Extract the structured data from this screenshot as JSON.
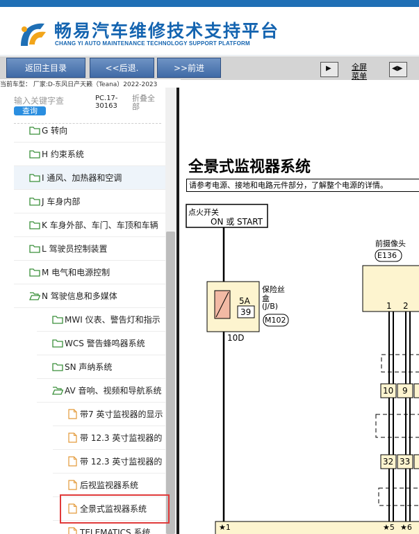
{
  "header": {
    "title": "畅易汽车维修技术支持平台",
    "subtitle": "CHANG YI AUTO MAINTENANCE TECHNOLOGY SUPPORT PLATFORM"
  },
  "toolbar": {
    "home_label": "返回主目录",
    "back_label": "<<后退.",
    "forward_label": ">>前进",
    "fullscreen_label_1": "全屏",
    "fullscreen_label_2": "菜单"
  },
  "vehicle": {
    "info": "当前车型：  厂家:D-东风日产天籁（Teana）2022-2023"
  },
  "sidebar": {
    "search_placeholder": "输入关键字查",
    "query_label": "查询",
    "code": "PC.17-30163",
    "collapse_label": "折叠全部",
    "items": [
      {
        "label": "G 转向"
      },
      {
        "label": "H 约束系统"
      },
      {
        "label": "I 通风、加热器和空调"
      },
      {
        "label": "J 车身内部"
      },
      {
        "label": "K 车身外部、车门、车顶和车辆"
      },
      {
        "label": "L 驾驶员控制装置"
      },
      {
        "label": "M 电气和电源控制"
      },
      {
        "label": "N 驾驶信息和多媒体"
      },
      {
        "label": "MWI 仪表、警告灯和指示"
      },
      {
        "label": "WCS 警告蜂鸣器系统"
      },
      {
        "label": "SN 声纳系统"
      },
      {
        "label": "AV 音响、视频和导航系统"
      },
      {
        "label": "带7 英寸监视器的显示"
      },
      {
        "label": "带 12.3 英寸监视器的"
      },
      {
        "label": "带 12.3 英寸监视器的"
      },
      {
        "label": "后视监视器系统"
      },
      {
        "label": "全景式监视器系统"
      },
      {
        "label": "TELEMATICS 系统"
      }
    ]
  },
  "diagram": {
    "title": "全景式监视器系统",
    "note": "请参考电源、接地和电路元件部分，了解整个电源的详情。",
    "ignition_1": "点火开关",
    "ignition_2": "ON 或 START",
    "fuse_label_1": "保险丝",
    "fuse_label_2": "盒",
    "fuse_label_3": "(J/B)",
    "fuse_rating": "5A",
    "fuse_number": "39",
    "fuse_connector": "M102",
    "fuse_terminal": "10D",
    "camera_label": "前摄像头",
    "camera_connector": "E136",
    "pin_1": "1",
    "pin_2": "2",
    "pin_10": "10",
    "pin_9": "9",
    "pin_32": "32",
    "pin_33": "33",
    "star_1": "★1",
    "star_5": "★5",
    "star_6": "★6"
  }
}
